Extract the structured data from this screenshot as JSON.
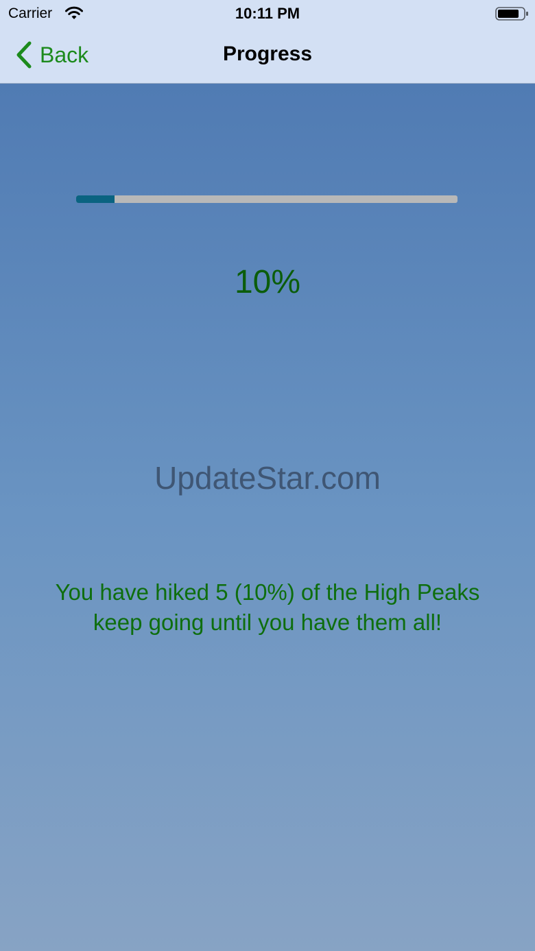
{
  "status_bar": {
    "carrier": "Carrier",
    "time": "10:11 PM",
    "icons": [
      "wifi-icon",
      "battery-icon"
    ]
  },
  "nav": {
    "back_label": "Back",
    "back_icon": "chevron-left-icon",
    "title": "Progress"
  },
  "progress": {
    "fraction": 0.1,
    "percent_label": "10%",
    "track_color": "#b8b8b8",
    "fill_color": "#0a6381"
  },
  "watermark": "UpdateStar.com",
  "message": {
    "line1": "You have hiked 5 (10%) of the High Peaks",
    "line2": "keep going until you have them all!"
  },
  "colors": {
    "accent": "#1c8a1c",
    "nav_background": "#d3e0f4",
    "content_top": "#507bb3",
    "content_bottom": "#87a3c4"
  }
}
